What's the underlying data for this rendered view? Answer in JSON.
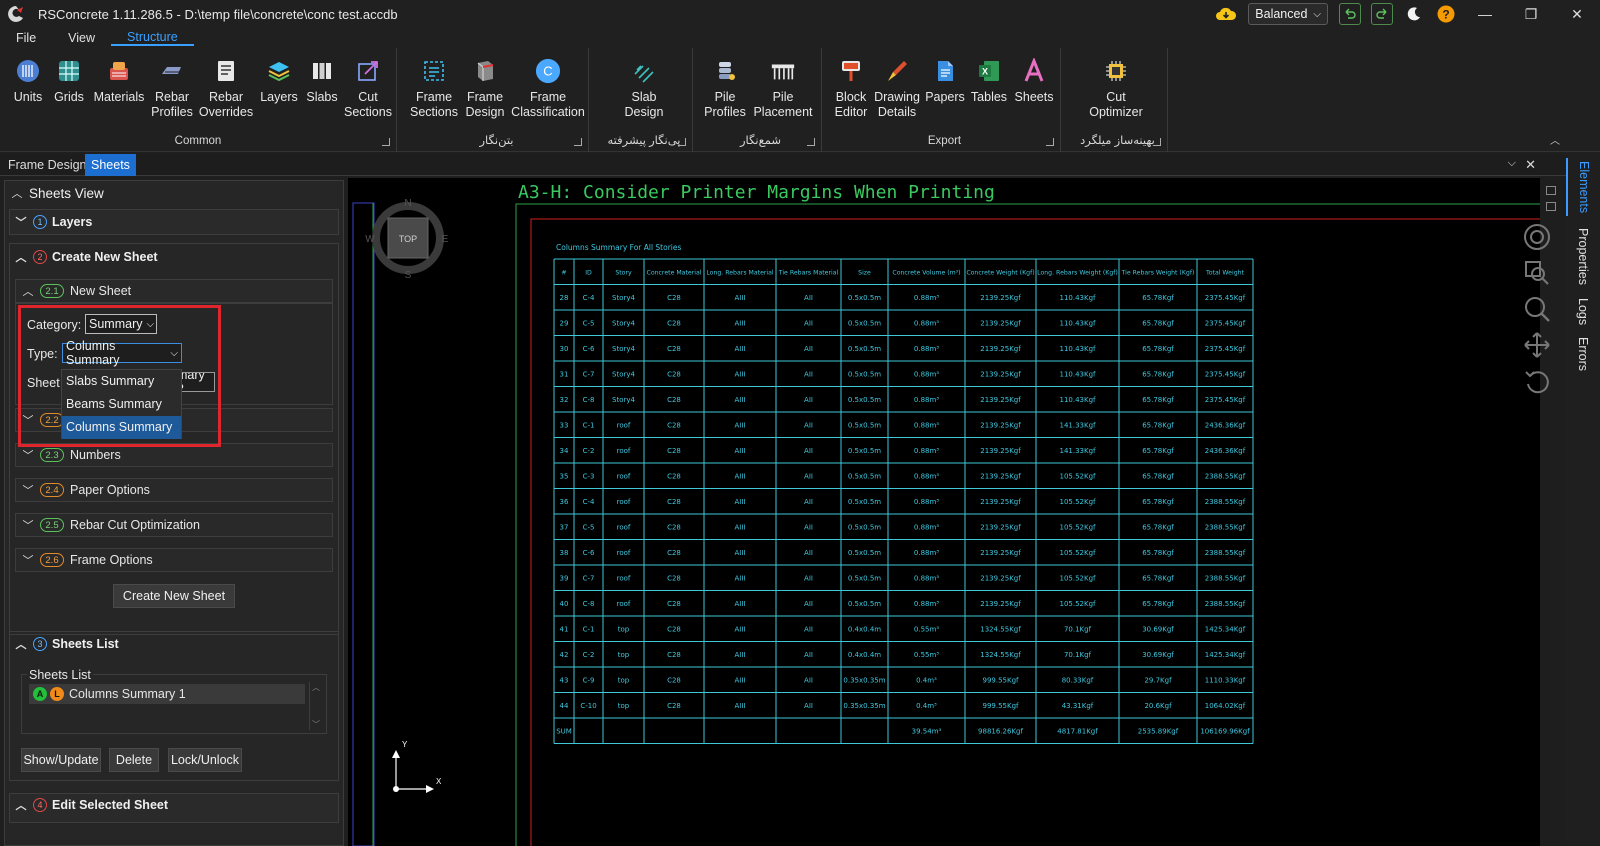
{
  "window": {
    "title": "RSConcrete 1.11.286.5 - D:\\temp file\\concrete\\conc test.accdb",
    "balanced_label": "Balanced",
    "minimize": "—",
    "maximize": "❐",
    "close": "✕"
  },
  "menu": {
    "items": [
      "File",
      "View",
      "Structure"
    ]
  },
  "ribbon": {
    "common": {
      "label": "Common",
      "buttons": [
        {
          "l1": "Units",
          "l2": ""
        },
        {
          "l1": "Grids",
          "l2": ""
        },
        {
          "l1": "Materials",
          "l2": ""
        },
        {
          "l1": "Rebar",
          "l2": "Profiles"
        },
        {
          "l1": "Rebar",
          "l2": "Overrides"
        },
        {
          "l1": "Layers",
          "l2": ""
        },
        {
          "l1": "Slabs",
          "l2": ""
        },
        {
          "l1": "Cut",
          "l2": "Sections"
        }
      ]
    },
    "frames": {
      "label": "بتن‌نگار",
      "buttons": [
        {
          "l1": "Frame",
          "l2": "Sections"
        },
        {
          "l1": "Frame",
          "l2": "Design"
        },
        {
          "l1": "Frame",
          "l2": "Classification"
        }
      ]
    },
    "slab": {
      "label": "پی‌نگار پیشرفته",
      "buttons": [
        {
          "l1": "Slab",
          "l2": "Design"
        }
      ]
    },
    "pile": {
      "label": "شمع‌نگار",
      "buttons": [
        {
          "l1": "Pile",
          "l2": "Profiles"
        },
        {
          "l1": "Pile",
          "l2": "Placement"
        }
      ]
    },
    "export": {
      "label": "Export",
      "buttons": [
        {
          "l1": "Block",
          "l2": "Editor"
        },
        {
          "l1": "Drawing",
          "l2": "Details"
        },
        {
          "l1": "Papers",
          "l2": ""
        },
        {
          "l1": "Tables",
          "l2": ""
        },
        {
          "l1": "Sheets",
          "l2": ""
        }
      ]
    },
    "cut": {
      "label": "بهینه‌ساز میلگرد",
      "buttons": [
        {
          "l1": "Cut",
          "l2": "Optimizer"
        }
      ]
    }
  },
  "doc_tabs": [
    "Frame Design",
    "Sheets"
  ],
  "side_tabs": [
    "Elements",
    "Properties",
    "Logs",
    "Errors"
  ],
  "panel": {
    "title": "Sheets View",
    "s1": {
      "num": "1",
      "label": "Layers"
    },
    "s2": {
      "num": "2",
      "label": "Create New Sheet"
    },
    "s21": {
      "num": "2.1",
      "label": "New Sheet"
    },
    "category_label": "Category:",
    "category_value": "Summary",
    "type_label": "Type:",
    "type_value": "Columns Summary",
    "sheet_name_label": "Sheet N",
    "sheet_name_value": "Columns Summary 2",
    "sheet_name_visible": "mary 2",
    "s22": {
      "num": "2.2",
      "label": ""
    },
    "s23": {
      "num": "2.3",
      "label": "Numbers"
    },
    "s24": {
      "num": "2.4",
      "label": "Paper Options"
    },
    "s25": {
      "num": "2.5",
      "label": "Rebar Cut Optimization"
    },
    "s26": {
      "num": "2.6",
      "label": "Frame Options"
    },
    "create_button": "Create New Sheet",
    "s3": {
      "num": "3",
      "label": "Sheets List"
    },
    "list_group_label": "Sheets List",
    "list_items": [
      {
        "badge_a": "A",
        "badge_l": "L",
        "label": "Columns Summary 1"
      }
    ],
    "show_update": "Show/Update",
    "delete": "Delete",
    "lock_unlock": "Lock/Unlock",
    "s4": {
      "num": "4",
      "label": "Edit Selected Sheet"
    },
    "type_options": [
      "Slabs Summary",
      "Beams Summary",
      "Columns Summary"
    ]
  },
  "drawing": {
    "sheet_title": "A3-H: Consider Printer Margins When Printing",
    "table_title": "Columns Summary For All Stories",
    "viewcube": {
      "top": "TOP",
      "n": "N",
      "s": "S",
      "e": "E",
      "w": "W"
    },
    "axis_x": "X",
    "axis_y": "Y",
    "headers": [
      "#",
      "ID",
      "Story",
      "Concrete Material",
      "Long. Rebars Material",
      "Tie Rebars Material",
      "Size",
      "Concrete Volume (m³)",
      "Concrete Weight (Kgf)",
      "Long. Rebars Weight (Kgf)",
      "Tie Rebars Weight (Kgf)",
      "Total Weight"
    ],
    "rows": [
      [
        "28",
        "C-4",
        "Story4",
        "C28",
        "AIII",
        "AII",
        "0.5x0.5m",
        "0.88m³",
        "2139.25Kgf",
        "110.43Kgf",
        "65.78Kgf",
        "2375.45Kgf"
      ],
      [
        "29",
        "C-5",
        "Story4",
        "C28",
        "AIII",
        "AII",
        "0.5x0.5m",
        "0.88m³",
        "2139.25Kgf",
        "110.43Kgf",
        "65.78Kgf",
        "2375.45Kgf"
      ],
      [
        "30",
        "C-6",
        "Story4",
        "C28",
        "AIII",
        "AII",
        "0.5x0.5m",
        "0.88m³",
        "2139.25Kgf",
        "110.43Kgf",
        "65.78Kgf",
        "2375.45Kgf"
      ],
      [
        "31",
        "C-7",
        "Story4",
        "C28",
        "AIII",
        "AII",
        "0.5x0.5m",
        "0.88m³",
        "2139.25Kgf",
        "110.43Kgf",
        "65.78Kgf",
        "2375.45Kgf"
      ],
      [
        "32",
        "C-8",
        "Story4",
        "C28",
        "AIII",
        "AII",
        "0.5x0.5m",
        "0.88m³",
        "2139.25Kgf",
        "110.43Kgf",
        "65.78Kgf",
        "2375.45Kgf"
      ],
      [
        "33",
        "C-1",
        "roof",
        "C28",
        "AIII",
        "AII",
        "0.5x0.5m",
        "0.88m³",
        "2139.25Kgf",
        "141.33Kgf",
        "65.78Kgf",
        "2436.36Kgf"
      ],
      [
        "34",
        "C-2",
        "roof",
        "C28",
        "AIII",
        "AII",
        "0.5x0.5m",
        "0.88m³",
        "2139.25Kgf",
        "141.33Kgf",
        "65.78Kgf",
        "2436.36Kgf"
      ],
      [
        "35",
        "C-3",
        "roof",
        "C28",
        "AIII",
        "AII",
        "0.5x0.5m",
        "0.88m³",
        "2139.25Kgf",
        "105.52Kgf",
        "65.78Kgf",
        "2388.55Kgf"
      ],
      [
        "36",
        "C-4",
        "roof",
        "C28",
        "AIII",
        "AII",
        "0.5x0.5m",
        "0.88m³",
        "2139.25Kgf",
        "105.52Kgf",
        "65.78Kgf",
        "2388.55Kgf"
      ],
      [
        "37",
        "C-5",
        "roof",
        "C28",
        "AIII",
        "AII",
        "0.5x0.5m",
        "0.88m³",
        "2139.25Kgf",
        "105.52Kgf",
        "65.78Kgf",
        "2388.55Kgf"
      ],
      [
        "38",
        "C-6",
        "roof",
        "C28",
        "AIII",
        "AII",
        "0.5x0.5m",
        "0.88m³",
        "2139.25Kgf",
        "105.52Kgf",
        "65.78Kgf",
        "2388.55Kgf"
      ],
      [
        "39",
        "C-7",
        "roof",
        "C28",
        "AIII",
        "AII",
        "0.5x0.5m",
        "0.88m³",
        "2139.25Kgf",
        "105.52Kgf",
        "65.78Kgf",
        "2388.55Kgf"
      ],
      [
        "40",
        "C-8",
        "roof",
        "C28",
        "AIII",
        "AII",
        "0.5x0.5m",
        "0.88m³",
        "2139.25Kgf",
        "105.52Kgf",
        "65.78Kgf",
        "2388.55Kgf"
      ],
      [
        "41",
        "C-1",
        "top",
        "C28",
        "AIII",
        "AII",
        "0.4x0.4m",
        "0.55m³",
        "1324.55Kgf",
        "70.1Kgf",
        "30.69Kgf",
        "1425.34Kgf"
      ],
      [
        "42",
        "C-2",
        "top",
        "C28",
        "AIII",
        "AII",
        "0.4x0.4m",
        "0.55m³",
        "1324.55Kgf",
        "70.1Kgf",
        "30.69Kgf",
        "1425.34Kgf"
      ],
      [
        "43",
        "C-9",
        "top",
        "C28",
        "AIII",
        "AII",
        "0.35x0.35m",
        "0.4m³",
        "999.55Kgf",
        "80.33Kgf",
        "29.7Kgf",
        "1110.33Kgf"
      ],
      [
        "44",
        "C-10",
        "top",
        "C28",
        "AIII",
        "AII",
        "0.35x0.35m",
        "0.4m³",
        "999.55Kgf",
        "43.31Kgf",
        "20.6Kgf",
        "1064.02Kgf"
      ]
    ],
    "sum_row": [
      "SUM",
      "",
      "",
      "",
      "",
      "",
      "",
      "39.54m³",
      "98816.26Kgf",
      "4817.81Kgf",
      "2535.89Kgf",
      "106169.96Kgf"
    ]
  }
}
